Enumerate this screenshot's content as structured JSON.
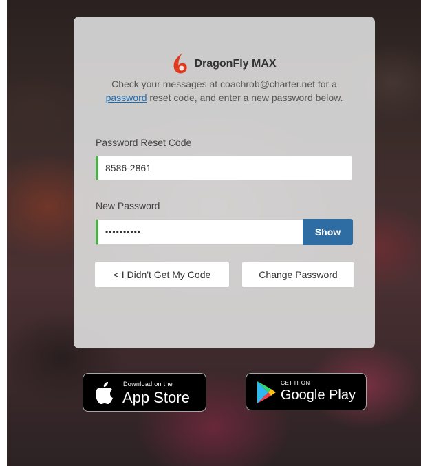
{
  "brand": {
    "name": "DragonFly MAX",
    "accent_color": "#e03a1e"
  },
  "instructions": {
    "part1": "Check your messages at coachrob@charter.net for a ",
    "link": "password",
    "part2": " reset code, and enter a new password below."
  },
  "form": {
    "reset_code_label": "Password Reset Code",
    "reset_code_value": "8586-2861",
    "new_password_label": "New Password",
    "new_password_value": "••••••••••",
    "show_button": "Show"
  },
  "actions": {
    "no_code": "< I Didn't Get My Code",
    "change_password": "Change Password"
  },
  "badges": {
    "app_store_small": "Download on the",
    "app_store_big": "App Store",
    "google_play_small": "GET IT ON",
    "google_play_big": "Google Play"
  }
}
